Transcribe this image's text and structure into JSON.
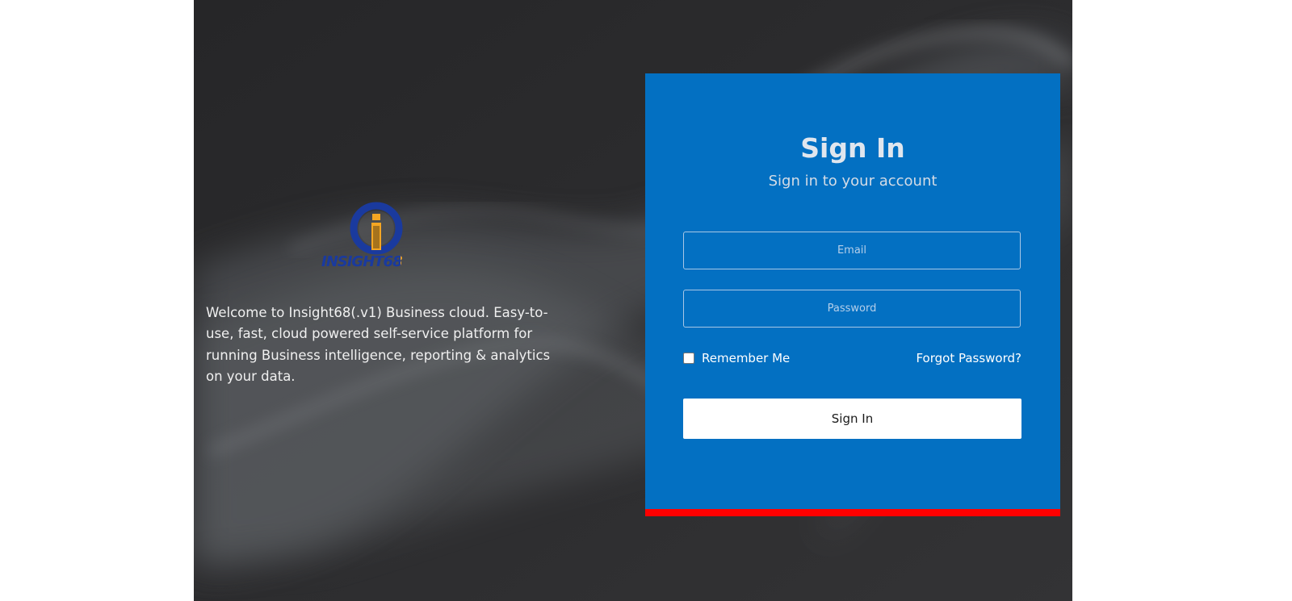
{
  "brand": {
    "logo_text": "INSIGHT68",
    "logo_letter": "i",
    "welcome_text": "Welcome to Insight68(.v1) Business cloud. Easy-to-use, fast, cloud powered self-service platform for running Business intelligence, reporting & analytics on your data."
  },
  "signin": {
    "title": "Sign In",
    "subtitle": "Sign in to your account",
    "email_placeholder": "Email",
    "password_placeholder": "Password",
    "remember_label": "Remember Me",
    "remember_checked": false,
    "forgot_label": "Forgot Password?",
    "submit_label": "Sign In"
  },
  "colors": {
    "card_background": "#0370c2",
    "card_accent_bar": "#ff0000",
    "page_background": "#2e2e30",
    "logo_ring": "#1a3a9e",
    "logo_accent": "#f5a623"
  }
}
